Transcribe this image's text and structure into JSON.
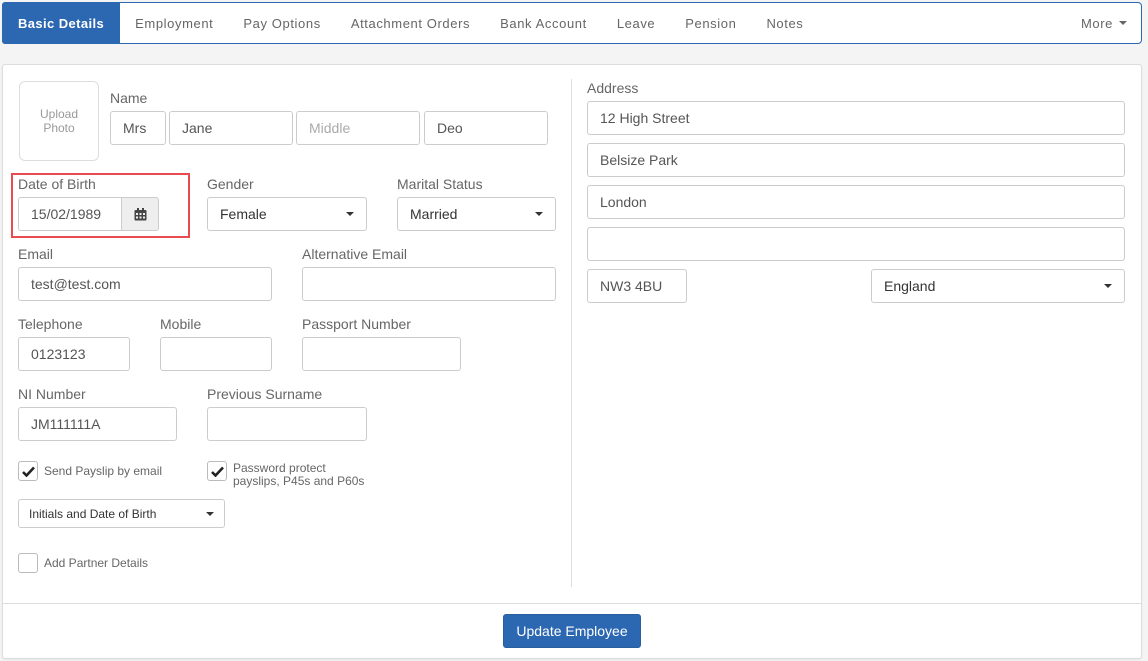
{
  "tabs": [
    {
      "label": "Basic Details",
      "active": true
    },
    {
      "label": "Employment"
    },
    {
      "label": "Pay Options"
    },
    {
      "label": "Attachment Orders"
    },
    {
      "label": "Bank Account"
    },
    {
      "label": "Leave"
    },
    {
      "label": "Pension"
    },
    {
      "label": "Notes"
    }
  ],
  "more_label": "More",
  "upload_photo": {
    "line1": "Upload",
    "line2": "Photo"
  },
  "name": {
    "label": "Name",
    "title": "Mrs",
    "first": "Jane",
    "middle_placeholder": "Middle",
    "last": "Deo"
  },
  "dob": {
    "label": "Date of Birth",
    "value": "15/02/1989",
    "icon": "calendar-icon",
    "highlight_color": "#e84c4f"
  },
  "gender": {
    "label": "Gender",
    "value": "Female"
  },
  "marital": {
    "label": "Marital Status",
    "value": "Married"
  },
  "email": {
    "label": "Email",
    "value": "test@test.com"
  },
  "alt_email": {
    "label": "Alternative Email",
    "value": ""
  },
  "telephone": {
    "label": "Telephone",
    "value": "0123123"
  },
  "mobile": {
    "label": "Mobile",
    "value": ""
  },
  "passport": {
    "label": "Passport Number",
    "value": ""
  },
  "ni": {
    "label": "NI Number",
    "value": "JM111111A"
  },
  "prev_surname": {
    "label": "Previous Surname",
    "value": ""
  },
  "send_payslip": {
    "label": "Send Payslip by email",
    "checked": true
  },
  "password_protect": {
    "line1": "Password protect",
    "line2": "payslips, P45s and P60s",
    "checked": true
  },
  "password_type": {
    "value": "Initials and Date of Birth"
  },
  "partner": {
    "label": "Add Partner Details",
    "checked": false
  },
  "address": {
    "label": "Address",
    "line1": "12 High Street",
    "line2": "Belsize Park",
    "line3": "London",
    "line4": "",
    "postcode": "NW3 4BU",
    "country": "England"
  },
  "update_button": "Update Employee",
  "colors": {
    "primary": "#2c67b2",
    "highlight": "#e84c4f"
  }
}
